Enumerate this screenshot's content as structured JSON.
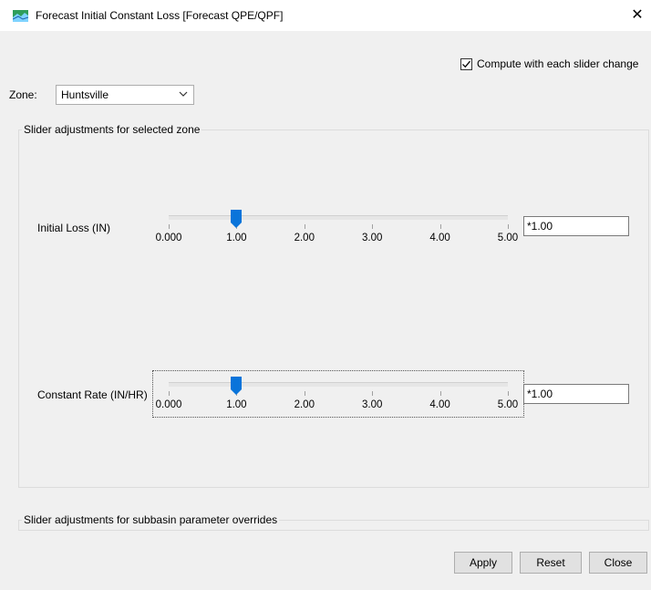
{
  "window": {
    "title": "Forecast Initial Constant Loss [Forecast QPE/QPF]",
    "close_glyph": "✕",
    "icon": "hec-hms-app-icon"
  },
  "options": {
    "compute_each_change_label": "Compute with each slider change",
    "compute_each_change_checked": true
  },
  "zone": {
    "label": "Zone:",
    "selected": "Huntsville"
  },
  "groups": {
    "selected_zone_title": "Slider adjustments for selected zone",
    "subbasin_overrides_title": "Slider adjustments for subbasin parameter overrides"
  },
  "sliders": [
    {
      "label": "Initial Loss (IN)",
      "ticks": [
        "0.000",
        "1.00",
        "2.00",
        "3.00",
        "4.00",
        "5.00"
      ],
      "value": 1.0,
      "min": 0,
      "max": 5,
      "field_value": "*1.00",
      "focused": false
    },
    {
      "label": "Constant Rate (IN/HR)",
      "ticks": [
        "0.000",
        "1.00",
        "2.00",
        "3.00",
        "4.00",
        "5.00"
      ],
      "value": 1.0,
      "min": 0,
      "max": 5,
      "field_value": "*1.00",
      "focused": true
    }
  ],
  "buttons": {
    "apply": "Apply",
    "reset": "Reset",
    "close": "Close"
  },
  "colors": {
    "thumb": "#0a74da",
    "background": "#f0f0f0"
  }
}
